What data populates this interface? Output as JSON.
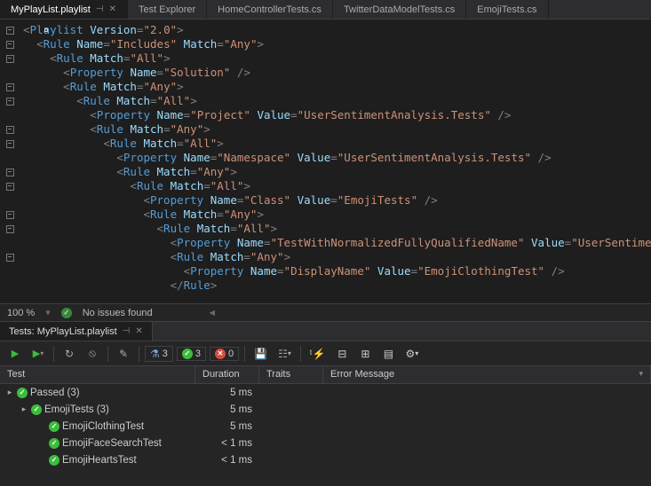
{
  "doc_tabs": [
    {
      "label": "MyPlayList.playlist",
      "active": true,
      "pinned": true,
      "closable": true
    },
    {
      "label": "Test Explorer"
    },
    {
      "label": "HomeControllerTests.cs"
    },
    {
      "label": "TwitterDataModelTests.cs"
    },
    {
      "label": "EmojiTests.cs"
    }
  ],
  "code": {
    "lines": [
      {
        "ind": 0,
        "fold": true,
        "html": "<span class='pu'>&lt;</span><span class='tag'>Playlist</span> <span class='attr'>Version</span><span class='pu'>=</span><span class='str'>\"2.0\"</span><span class='pu'>&gt;</span>"
      },
      {
        "ind": 1,
        "fold": true,
        "html": "<span class='pu'>&lt;</span><span class='tag'>Rule</span> <span class='attr'>Name</span><span class='pu'>=</span><span class='str'>\"Includes\"</span> <span class='attr'>Match</span><span class='pu'>=</span><span class='str'>\"Any\"</span><span class='pu'>&gt;</span>"
      },
      {
        "ind": 2,
        "fold": true,
        "html": "<span class='pu'>&lt;</span><span class='tag'>Rule</span> <span class='attr'>Match</span><span class='pu'>=</span><span class='str'>\"All\"</span><span class='pu'>&gt;</span>"
      },
      {
        "ind": 3,
        "fold": false,
        "html": "<span class='pu'>&lt;</span><span class='tag'>Property</span> <span class='attr'>Name</span><span class='pu'>=</span><span class='str'>\"Solution\"</span> <span class='pu'>/&gt;</span>"
      },
      {
        "ind": 3,
        "fold": true,
        "html": "<span class='pu'>&lt;</span><span class='tag'>Rule</span> <span class='attr'>Match</span><span class='pu'>=</span><span class='str'>\"Any\"</span><span class='pu'>&gt;</span>"
      },
      {
        "ind": 4,
        "fold": true,
        "html": "<span class='pu'>&lt;</span><span class='tag'>Rule</span> <span class='attr'>Match</span><span class='pu'>=</span><span class='str'>\"All\"</span><span class='pu'>&gt;</span>"
      },
      {
        "ind": 5,
        "fold": false,
        "html": "<span class='pu'>&lt;</span><span class='tag'>Property</span> <span class='attr'>Name</span><span class='pu'>=</span><span class='str'>\"Project\"</span> <span class='attr'>Value</span><span class='pu'>=</span><span class='str'>\"UserSentimentAnalysis.Tests\"</span> <span class='pu'>/&gt;</span>"
      },
      {
        "ind": 5,
        "fold": true,
        "html": "<span class='pu'>&lt;</span><span class='tag'>Rule</span> <span class='attr'>Match</span><span class='pu'>=</span><span class='str'>\"Any\"</span><span class='pu'>&gt;</span>"
      },
      {
        "ind": 6,
        "fold": true,
        "html": "<span class='pu'>&lt;</span><span class='tag'>Rule</span> <span class='attr'>Match</span><span class='pu'>=</span><span class='str'>\"All\"</span><span class='pu'>&gt;</span>"
      },
      {
        "ind": 7,
        "fold": false,
        "html": "<span class='pu'>&lt;</span><span class='tag'>Property</span> <span class='attr'>Name</span><span class='pu'>=</span><span class='str'>\"Namespace\"</span> <span class='attr'>Value</span><span class='pu'>=</span><span class='str'>\"UserSentimentAnalysis.Tests\"</span> <span class='pu'>/&gt;</span>"
      },
      {
        "ind": 7,
        "fold": true,
        "html": "<span class='pu'>&lt;</span><span class='tag'>Rule</span> <span class='attr'>Match</span><span class='pu'>=</span><span class='str'>\"Any\"</span><span class='pu'>&gt;</span>"
      },
      {
        "ind": 8,
        "fold": true,
        "html": "<span class='pu'>&lt;</span><span class='tag'>Rule</span> <span class='attr'>Match</span><span class='pu'>=</span><span class='str'>\"All\"</span><span class='pu'>&gt;</span>"
      },
      {
        "ind": 9,
        "fold": false,
        "html": "<span class='pu'>&lt;</span><span class='tag'>Property</span> <span class='attr'>Name</span><span class='pu'>=</span><span class='str'>\"Class\"</span> <span class='attr'>Value</span><span class='pu'>=</span><span class='str'>\"EmojiTests\"</span> <span class='pu'>/&gt;</span>"
      },
      {
        "ind": 9,
        "fold": true,
        "html": "<span class='pu'>&lt;</span><span class='tag'>Rule</span> <span class='attr'>Match</span><span class='pu'>=</span><span class='str'>\"Any\"</span><span class='pu'>&gt;</span>"
      },
      {
        "ind": 10,
        "fold": true,
        "html": "<span class='pu'>&lt;</span><span class='tag'>Rule</span> <span class='attr'>Match</span><span class='pu'>=</span><span class='str'>\"All\"</span><span class='pu'>&gt;</span>"
      },
      {
        "ind": 11,
        "fold": false,
        "html": "<span class='pu'>&lt;</span><span class='tag'>Property</span> <span class='attr'>Name</span><span class='pu'>=</span><span class='str'>\"TestWithNormalizedFullyQualifiedName\"</span> <span class='attr'>Value</span><span class='pu'>=</span><span class='str'>\"UserSentimentA</span>"
      },
      {
        "ind": 11,
        "fold": true,
        "html": "<span class='pu'>&lt;</span><span class='tag'>Rule</span> <span class='attr'>Match</span><span class='pu'>=</span><span class='str'>\"Any\"</span><span class='pu'>&gt;</span>"
      },
      {
        "ind": 12,
        "fold": false,
        "html": "<span class='pu'>&lt;</span><span class='tag'>Property</span> <span class='attr'>Name</span><span class='pu'>=</span><span class='str'>\"DisplayName\"</span> <span class='attr'>Value</span><span class='pu'>=</span><span class='str'>\"EmojiClothingTest\"</span> <span class='pu'>/&gt;</span>"
      },
      {
        "ind": 11,
        "fold": false,
        "html": "<span class='pu'>&lt;/</span><span class='tag'>Rule</span><span class='pu'>&gt;</span>"
      }
    ]
  },
  "status": {
    "zoom": "100 %",
    "issues": "No issues found",
    "scroll_left_glyph": "◄"
  },
  "panel": {
    "tab": "Tests: MyPlayList.playlist",
    "toolbar": {
      "flask_count": "3",
      "pass_count": "3",
      "fail_count": "0"
    },
    "columns": [
      "Test",
      "Duration",
      "Traits",
      "Error Message"
    ],
    "rows": [
      {
        "indent": 0,
        "caret": "▸",
        "icon": "pass",
        "label": "Passed (3)",
        "dur": "5 ms"
      },
      {
        "indent": 1,
        "caret": "▸",
        "icon": "pass",
        "label": "EmojiTests (3)",
        "dur": "5 ms"
      },
      {
        "indent": 2,
        "caret": "",
        "icon": "pass",
        "label": "EmojiClothingTest",
        "dur": "5 ms"
      },
      {
        "indent": 2,
        "caret": "",
        "icon": "pass",
        "label": "EmojiFaceSearchTest",
        "dur": "< 1 ms"
      },
      {
        "indent": 2,
        "caret": "",
        "icon": "pass",
        "label": "EmojiHeartsTest",
        "dur": "< 1 ms"
      }
    ]
  }
}
